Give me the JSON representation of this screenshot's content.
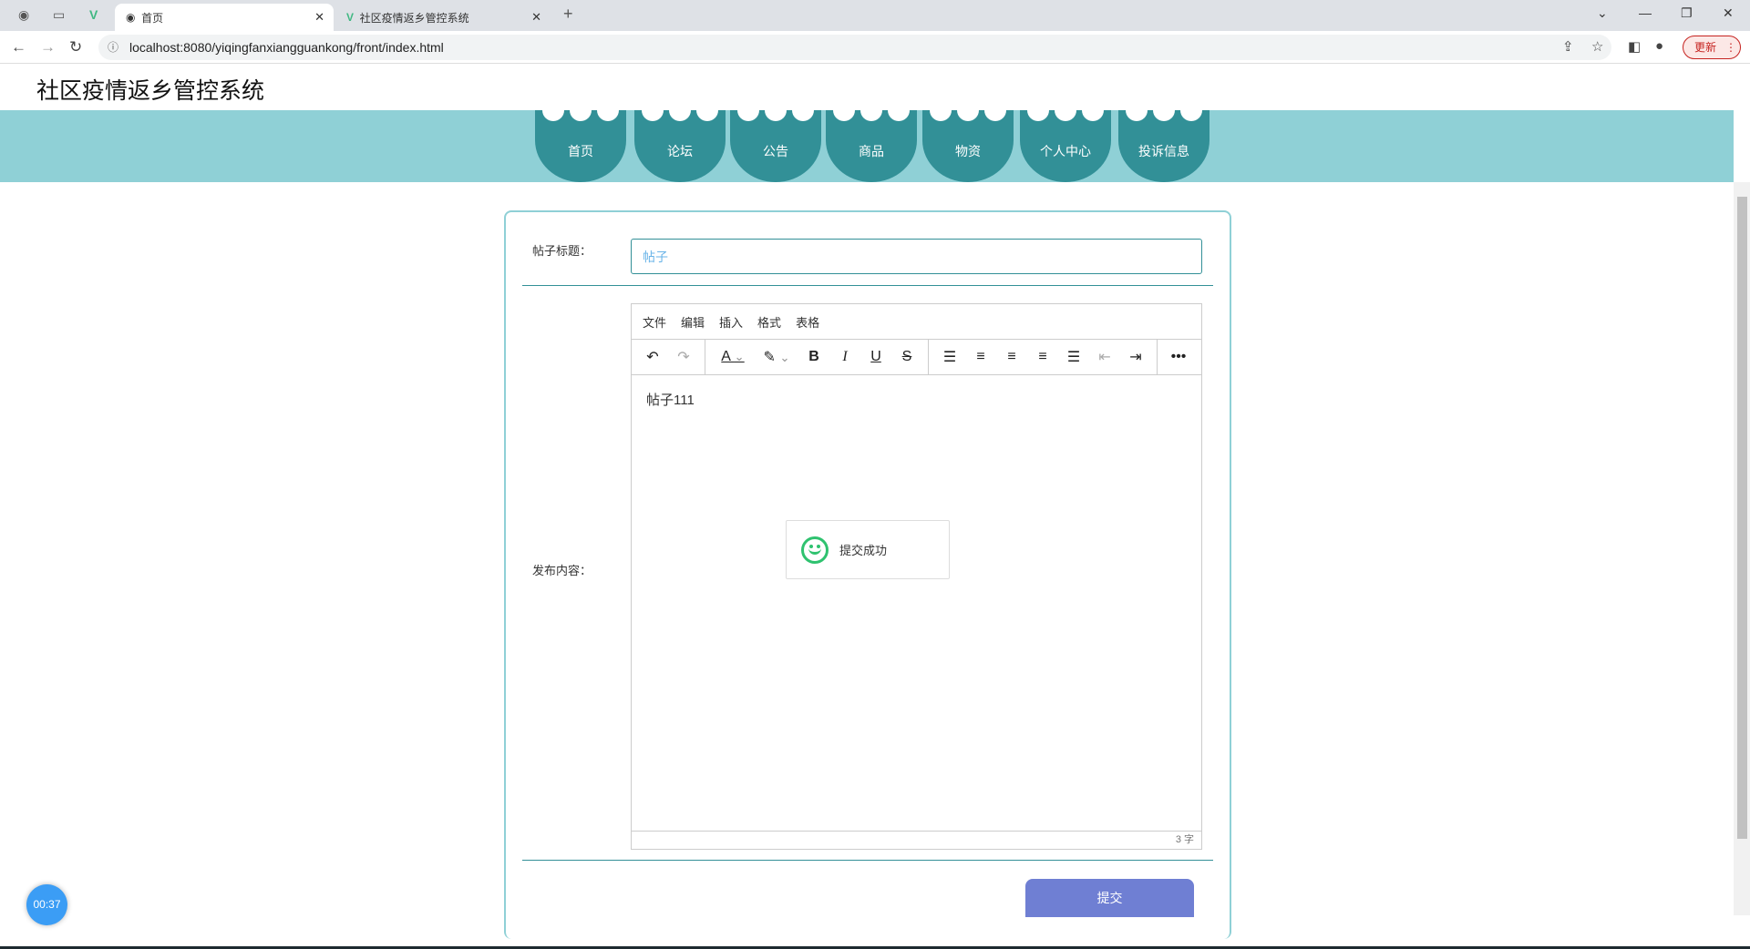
{
  "browser": {
    "tabs": [
      {
        "label": "首页",
        "active": true
      },
      {
        "label": "社区疫情返乡管控系统",
        "active": false
      }
    ],
    "url": "localhost:8080/yiqingfanxiangguankong/front/index.html",
    "update_label": "更新"
  },
  "site": {
    "title": "社区疫情返乡管控系统",
    "nav": [
      "首页",
      "论坛",
      "公告",
      "商品",
      "物资",
      "个人中心",
      "投诉信息"
    ]
  },
  "form": {
    "title_label": "帖子标题：",
    "title_value": "帖子",
    "content_label": "发布内容：",
    "submit_label": "提交"
  },
  "editor": {
    "menus": [
      "文件",
      "编辑",
      "插入",
      "格式",
      "表格"
    ],
    "content": "帖子111",
    "word_count": "3 字"
  },
  "toast": {
    "message": "提交成功"
  },
  "timer": "00:37",
  "colors": {
    "nav": "#329097",
    "band": "#8fd0d6",
    "submit": "#6f7fd3",
    "success": "#2fc26f"
  }
}
